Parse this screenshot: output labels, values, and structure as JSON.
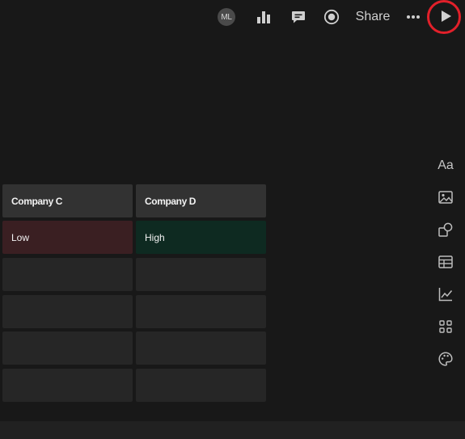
{
  "toolbar": {
    "avatar_initials": "ML",
    "share_label": "Share",
    "icons": [
      "bar-chart-icon",
      "comment-icon",
      "record-icon",
      "more-icon",
      "play-icon"
    ],
    "highlight_color": "#e2202a"
  },
  "table": {
    "headers": [
      "Company C",
      "Company D"
    ],
    "rows": [
      [
        "Low",
        "High"
      ],
      [
        "",
        ""
      ],
      [
        "",
        ""
      ],
      [
        "",
        ""
      ],
      [
        "",
        ""
      ]
    ],
    "colors": {
      "low": "#3a1f22",
      "high": "#0e2a21"
    }
  },
  "sidebar": {
    "text_tool_label": "Aa",
    "tools": [
      "text-icon",
      "image-icon",
      "shapes-icon",
      "table-icon",
      "line-chart-icon",
      "grid-icon",
      "palette-icon"
    ]
  }
}
